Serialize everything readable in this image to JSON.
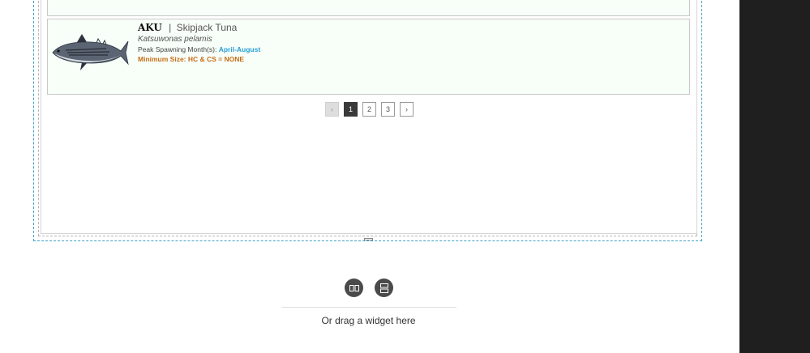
{
  "species_card": {
    "code": "AKU",
    "separator": "|",
    "common_name": "Skipjack Tuna",
    "scientific_name": "Katsuwonas pelamis",
    "spawning_label": "Peak Spawning Month(s):",
    "spawning_value": "April-August",
    "minimum_size": "Minimum Size: HC & CS = NONE"
  },
  "pagination": {
    "prev": "‹",
    "pages": [
      "1",
      "2",
      "3"
    ],
    "active_page": "1",
    "next": "›"
  },
  "drop_zone": {
    "hint": "Or drag a widget here",
    "buttons": [
      "columns-layout-icon",
      "rows-layout-icon"
    ]
  },
  "colors": {
    "card_background": "#f7fff8",
    "spawning_month": "#2a9fd6",
    "minimum_size": "#c96b16",
    "selection_border": "#3fa3c9",
    "active_page": "#3a3a3a"
  }
}
